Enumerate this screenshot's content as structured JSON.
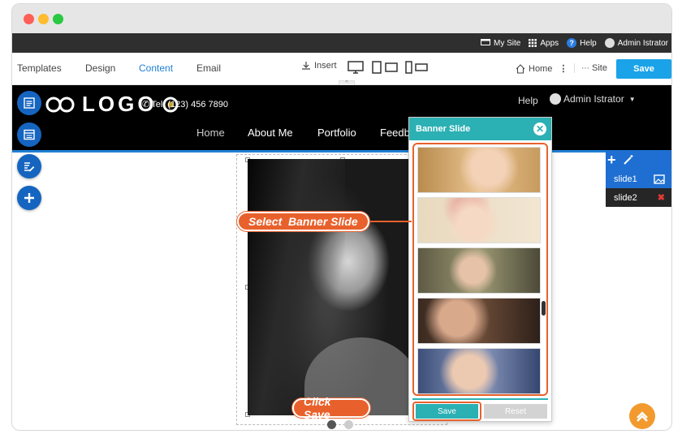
{
  "adminbar": {
    "my_site": "My Site",
    "apps": "Apps",
    "help": "Help",
    "user": "Admin Istrator"
  },
  "toolbar": {
    "tabs": [
      "Templates",
      "Design",
      "Content",
      "Email"
    ],
    "insert": "Insert",
    "home": "Home",
    "site": "Site",
    "save": "Save"
  },
  "site": {
    "logo": "LOGO",
    "tel": "Tel. (123) 456 7890",
    "help": "Help",
    "user": "Admin Istrator",
    "nav": [
      "Home",
      "About Me",
      "Portfolio",
      "Feedb"
    ]
  },
  "panel": {
    "title": "Banner Slide",
    "save": "Save",
    "reset": "Reset"
  },
  "callouts": {
    "select": "Select  Banner Slide",
    "click_save": "Click Save"
  },
  "slides": {
    "items": [
      "slide1",
      "slide2"
    ]
  },
  "colors": {
    "accent": "#2bb0b3",
    "callout": "#e8612c",
    "brand_blue": "#1565c0",
    "save_blue": "#1aa3e8"
  }
}
